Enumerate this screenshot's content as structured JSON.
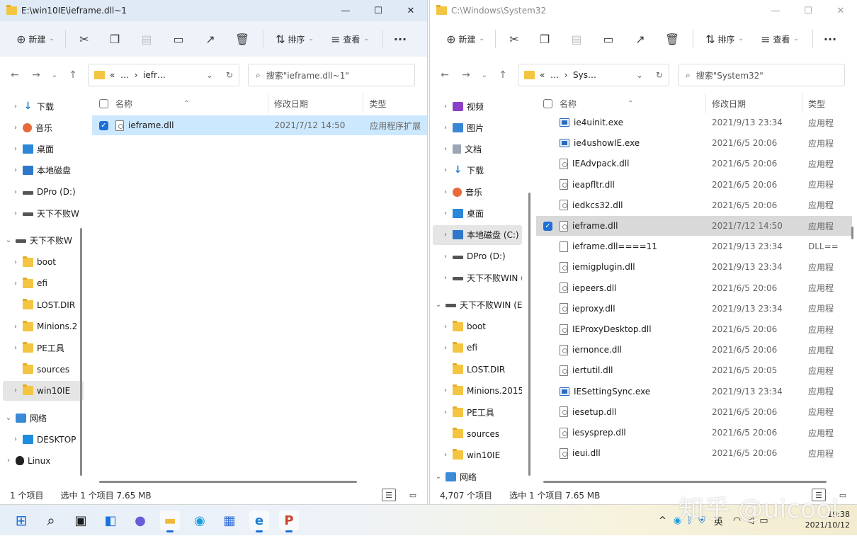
{
  "left": {
    "title": "E:\\win10IE\\ieframe.dll~1",
    "toolbar": {
      "new": "新建",
      "sort": "排序",
      "view": "查看",
      "more": "···"
    },
    "address": {
      "prefix": "«",
      "ellipsis": "…",
      "current": "iefr…"
    },
    "search_placeholder": "搜索\"ieframe.dll~1\"",
    "tree": [
      {
        "label": "下载",
        "icon": "download-icon",
        "chev": "›"
      },
      {
        "label": "音乐",
        "icon": "music-icon",
        "chev": "›"
      },
      {
        "label": "桌面",
        "icon": "desktop-icon",
        "chev": "›"
      },
      {
        "label": "本地磁盘",
        "icon": "local-disk-icon",
        "chev": "›"
      },
      {
        "label": "DPro (D:)",
        "icon": "drive-icon",
        "chev": "›"
      },
      {
        "label": "天下不败W",
        "icon": "drive-icon",
        "chev": "›"
      },
      {
        "label": "天下不败W",
        "icon": "drive-icon",
        "chev": "⌄"
      },
      {
        "label": "boot",
        "icon": "folder-icon",
        "chev": "›"
      },
      {
        "label": "efi",
        "icon": "folder-icon",
        "chev": "›"
      },
      {
        "label": "LOST.DIR",
        "icon": "folder-icon",
        "chev": ""
      },
      {
        "label": "Minions.2",
        "icon": "folder-icon",
        "chev": "›"
      },
      {
        "label": "PE工具",
        "icon": "folder-icon",
        "chev": "›"
      },
      {
        "label": "sources",
        "icon": "folder-icon",
        "chev": ""
      },
      {
        "label": "win10IE",
        "icon": "folder-icon",
        "chev": "›"
      },
      {
        "label": "网络",
        "icon": "network-icon",
        "chev": "⌄"
      },
      {
        "label": "DESKTOP",
        "icon": "pc-icon",
        "chev": "›"
      },
      {
        "label": "Linux",
        "icon": "linux-icon",
        "chev": "›"
      }
    ],
    "columns": {
      "name": "名称",
      "date": "修改日期",
      "type": "类型"
    },
    "files": [
      {
        "name": "ieframe.dll",
        "date": "2021/7/12 14:50",
        "type": "应用程序扩展",
        "selected": true,
        "kind": "dll"
      }
    ],
    "status": {
      "count": "1 个项目",
      "selected": "选中 1 个项目  7.65 MB"
    }
  },
  "right": {
    "title": "C:\\Windows\\System32",
    "toolbar": {
      "new": "新建",
      "sort": "排序",
      "view": "查看",
      "more": "···"
    },
    "address": {
      "prefix": "«",
      "ellipsis": "…",
      "current": "Sys…"
    },
    "search_placeholder": "搜索\"System32\"",
    "tree": [
      {
        "label": "视频",
        "icon": "video-icon",
        "chev": "›"
      },
      {
        "label": "图片",
        "icon": "picture-icon",
        "chev": "›"
      },
      {
        "label": "文档",
        "icon": "document-icon",
        "chev": "›"
      },
      {
        "label": "下载",
        "icon": "download-icon",
        "chev": "›"
      },
      {
        "label": "音乐",
        "icon": "music-icon",
        "chev": "›"
      },
      {
        "label": "桌面",
        "icon": "desktop-icon",
        "chev": "›"
      },
      {
        "label": "本地磁盘 (C:)",
        "icon": "local-disk-icon",
        "chev": "›"
      },
      {
        "label": "DPro (D:)",
        "icon": "drive-icon",
        "chev": "›"
      },
      {
        "label": "天下不败WIN (",
        "icon": "drive-icon",
        "chev": "›"
      },
      {
        "label": "天下不败WIN (E",
        "icon": "drive-icon",
        "chev": "⌄"
      },
      {
        "label": "boot",
        "icon": "folder-icon",
        "chev": "›"
      },
      {
        "label": "efi",
        "icon": "folder-icon",
        "chev": "›"
      },
      {
        "label": "LOST.DIR",
        "icon": "folder-icon",
        "chev": ""
      },
      {
        "label": "Minions.2015.",
        "icon": "folder-icon",
        "chev": "›"
      },
      {
        "label": "PE工具",
        "icon": "folder-icon",
        "chev": "›"
      },
      {
        "label": "sources",
        "icon": "folder-icon",
        "chev": ""
      },
      {
        "label": "win10IE",
        "icon": "folder-icon",
        "chev": "›"
      },
      {
        "label": "网络",
        "icon": "network-icon",
        "chev": "⌄"
      }
    ],
    "columns": {
      "name": "名称",
      "date": "修改日期",
      "type": "类型"
    },
    "files": [
      {
        "name": "ie4uinit.exe",
        "date": "2021/9/13 23:34",
        "type": "应用程",
        "kind": "exe"
      },
      {
        "name": "ie4ushowIE.exe",
        "date": "2021/6/5 20:06",
        "type": "应用程",
        "kind": "exe"
      },
      {
        "name": "IEAdvpack.dll",
        "date": "2021/6/5 20:06",
        "type": "应用程",
        "kind": "dll"
      },
      {
        "name": "ieapfltr.dll",
        "date": "2021/6/5 20:06",
        "type": "应用程",
        "kind": "dll"
      },
      {
        "name": "iedkcs32.dll",
        "date": "2021/6/5 20:06",
        "type": "应用程",
        "kind": "dll"
      },
      {
        "name": "ieframe.dll",
        "date": "2021/7/12 14:50",
        "type": "应用程",
        "kind": "dll",
        "selected": true
      },
      {
        "name": "ieframe.dll====11",
        "date": "2021/9/13 23:34",
        "type": "DLL==",
        "kind": "file"
      },
      {
        "name": "iemigplugin.dll",
        "date": "2021/9/13 23:34",
        "type": "应用程",
        "kind": "dll"
      },
      {
        "name": "iepeers.dll",
        "date": "2021/6/5 20:06",
        "type": "应用程",
        "kind": "dll"
      },
      {
        "name": "ieproxy.dll",
        "date": "2021/9/13 23:34",
        "type": "应用程",
        "kind": "dll"
      },
      {
        "name": "IEProxyDesktop.dll",
        "date": "2021/6/5 20:06",
        "type": "应用程",
        "kind": "dll"
      },
      {
        "name": "iernonce.dll",
        "date": "2021/6/5 20:06",
        "type": "应用程",
        "kind": "dll"
      },
      {
        "name": "iertutil.dll",
        "date": "2021/6/5 20:05",
        "type": "应用程",
        "kind": "dll"
      },
      {
        "name": "IESettingSync.exe",
        "date": "2021/9/13 23:34",
        "type": "应用程",
        "kind": "exe"
      },
      {
        "name": "iesetup.dll",
        "date": "2021/6/5 20:06",
        "type": "应用程",
        "kind": "dll"
      },
      {
        "name": "iesysprep.dll",
        "date": "2021/6/5 20:06",
        "type": "应用程",
        "kind": "dll"
      },
      {
        "name": "ieui.dll",
        "date": "2021/6/5 20:06",
        "type": "应用程",
        "kind": "dll"
      }
    ],
    "status": {
      "count": "4,707 个项目",
      "selected": "选中 1 个项目  7.65 MB"
    }
  },
  "taskbar": {
    "ime": "英",
    "time": "19:38",
    "date": "2021/10/12"
  },
  "watermark": "知乎 @uicool"
}
